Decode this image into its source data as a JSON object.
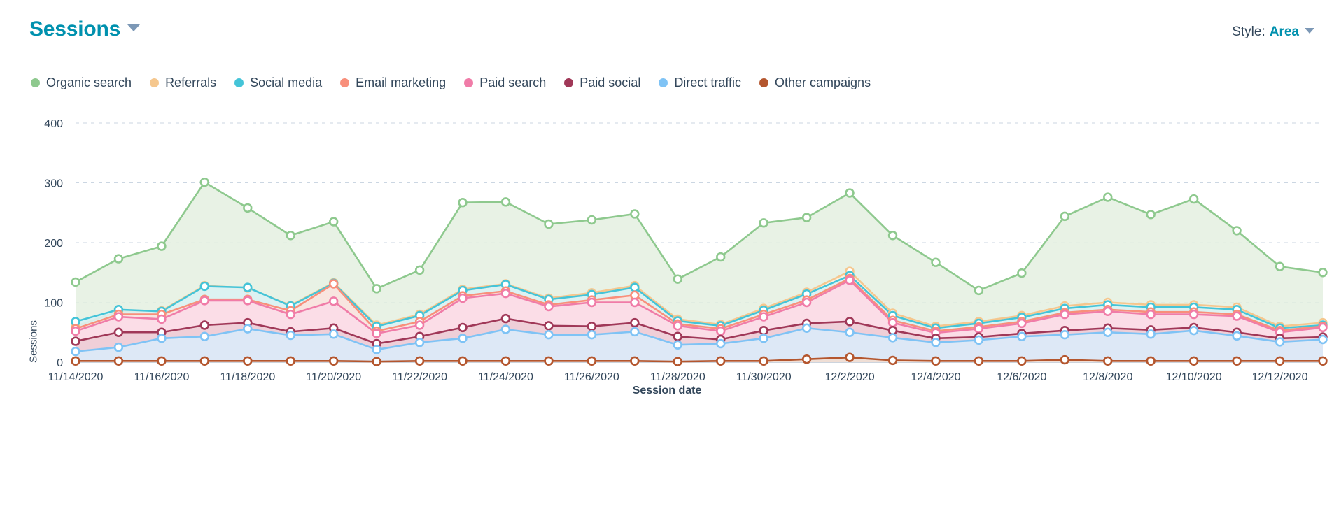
{
  "header": {
    "title": "Sessions",
    "title_caret_icon": "chevron-down-icon",
    "style_label": "Style:",
    "style_value": "Area",
    "style_caret_icon": "chevron-down-icon"
  },
  "chart_data": {
    "type": "area",
    "title": "Sessions",
    "xlabel": "Session date",
    "ylabel": "Sessions",
    "ylim": [
      0,
      400
    ],
    "yticks": [
      0,
      100,
      200,
      300,
      400
    ],
    "grid": true,
    "legend_position": "top-left",
    "stacked": false,
    "x": [
      "11/14/2020",
      "11/15/2020",
      "11/16/2020",
      "11/17/2020",
      "11/18/2020",
      "11/19/2020",
      "11/20/2020",
      "11/21/2020",
      "11/22/2020",
      "11/23/2020",
      "11/24/2020",
      "11/25/2020",
      "11/26/2020",
      "11/27/2020",
      "11/28/2020",
      "11/29/2020",
      "11/30/2020",
      "12/1/2020",
      "12/2/2020",
      "12/3/2020",
      "12/4/2020",
      "12/5/2020",
      "12/6/2020",
      "12/7/2020",
      "12/8/2020",
      "12/9/2020",
      "12/10/2020",
      "12/11/2020",
      "12/12/2020",
      "12/13/2020"
    ],
    "xtick_labels": [
      "11/14/2020",
      "11/16/2020",
      "11/18/2020",
      "11/20/2020",
      "11/22/2020",
      "11/24/2020",
      "11/26/2020",
      "11/28/2020",
      "11/30/2020",
      "12/2/2020",
      "12/4/2020",
      "12/6/2020",
      "12/8/2020",
      "12/10/2020",
      "12/12/2020"
    ],
    "series": [
      {
        "name": "Organic search",
        "color": "#8ec98e",
        "fill": "#e4f0e0",
        "values": [
          134,
          173,
          194,
          301,
          258,
          212,
          235,
          123,
          154,
          267,
          268,
          231,
          238,
          248,
          139,
          176,
          233,
          242,
          283,
          212,
          167,
          120,
          149,
          244,
          276,
          247,
          273,
          220,
          160,
          150
        ]
      },
      {
        "name": "Referrals",
        "color": "#f5c78e",
        "fill": "#fdf0de",
        "values": [
          60,
          85,
          86,
          128,
          124,
          95,
          133,
          62,
          80,
          122,
          131,
          107,
          116,
          128,
          72,
          63,
          90,
          117,
          152,
          82,
          60,
          68,
          78,
          94,
          100,
          96,
          96,
          92,
          60,
          66
        ]
      },
      {
        "name": "Social media",
        "color": "#44c4d8",
        "fill": "#d6f2f6",
        "values": [
          68,
          88,
          85,
          127,
          125,
          94,
          132,
          60,
          78,
          120,
          130,
          105,
          113,
          125,
          69,
          61,
          87,
          114,
          145,
          78,
          57,
          65,
          75,
          90,
          96,
          92,
          92,
          88,
          57,
          62
        ]
      },
      {
        "name": "Email marketing",
        "color": "#f88f7b",
        "fill": "#fde3dd",
        "values": [
          56,
          80,
          80,
          105,
          105,
          86,
          131,
          52,
          68,
          111,
          119,
          96,
          104,
          112,
          64,
          56,
          80,
          104,
          140,
          70,
          52,
          59,
          68,
          83,
          88,
          84,
          84,
          80,
          53,
          60
        ]
      },
      {
        "name": "Paid search",
        "color": "#f07ca8",
        "fill": "#fbdce7",
        "values": [
          52,
          76,
          72,
          103,
          103,
          80,
          102,
          48,
          62,
          107,
          115,
          93,
          100,
          100,
          61,
          52,
          76,
          100,
          137,
          66,
          49,
          56,
          65,
          80,
          85,
          80,
          80,
          77,
          50,
          58
        ]
      },
      {
        "name": "Paid social",
        "color": "#a03858",
        "fill": "#eccdd5",
        "values": [
          35,
          50,
          50,
          62,
          66,
          51,
          57,
          31,
          43,
          58,
          73,
          61,
          60,
          66,
          43,
          38,
          53,
          65,
          68,
          53,
          40,
          42,
          48,
          53,
          57,
          54,
          58,
          50,
          40,
          42
        ]
      },
      {
        "name": "Direct traffic",
        "color": "#7fc3f5",
        "fill": "#d9ecfb",
        "values": [
          18,
          25,
          40,
          43,
          56,
          45,
          47,
          21,
          33,
          40,
          55,
          46,
          46,
          51,
          29,
          31,
          40,
          57,
          50,
          41,
          33,
          37,
          43,
          46,
          50,
          47,
          53,
          44,
          34,
          38
        ]
      },
      {
        "name": "Other campaigns",
        "color": "#b4562e",
        "fill": "#f2dccf",
        "values": [
          2,
          2,
          2,
          2,
          2,
          2,
          2,
          1,
          2,
          2,
          2,
          2,
          2,
          2,
          1,
          2,
          2,
          5,
          8,
          3,
          2,
          2,
          2,
          4,
          2,
          2,
          2,
          2,
          2,
          2
        ]
      }
    ]
  }
}
